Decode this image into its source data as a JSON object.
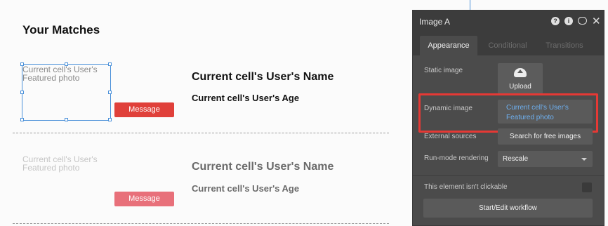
{
  "canvas": {
    "title": "Your Matches",
    "rows": [
      {
        "image_placeholder": "Current cell's User's Featured photo",
        "name": "Current cell's User's Name",
        "age": "Current cell's User's Age",
        "message_label": "Message"
      },
      {
        "image_placeholder": "Current cell's User's Featured photo",
        "name": "Current cell's User's Name",
        "age": "Current cell's User's Age",
        "message_label": "Message"
      }
    ]
  },
  "panel": {
    "title": "Image A",
    "header_icons": [
      "help-icon",
      "info-icon",
      "comment-icon",
      "close-icon"
    ],
    "tabs": [
      {
        "label": "Appearance",
        "active": true
      },
      {
        "label": "Conditional",
        "active": false
      },
      {
        "label": "Transitions",
        "active": false
      }
    ],
    "static_image": {
      "label": "Static image",
      "upload_label": "Upload"
    },
    "dynamic_image": {
      "label": "Dynamic image",
      "value": "Current cell's User's Featured photo"
    },
    "external_sources": {
      "label": "External sources",
      "button_label": "Search for free images"
    },
    "run_mode": {
      "label": "Run-mode rendering",
      "value": "Rescale"
    },
    "clickable": {
      "label": "This element isn't clickable",
      "checked": false
    },
    "workflow_button": "Start/Edit workflow"
  },
  "colors": {
    "selection": "#4a90d9",
    "message_button": "#e0403a",
    "highlight_box": "#e53935",
    "dynamic_text": "#6eb0f0",
    "panel_bg": "#4b4b4b"
  }
}
